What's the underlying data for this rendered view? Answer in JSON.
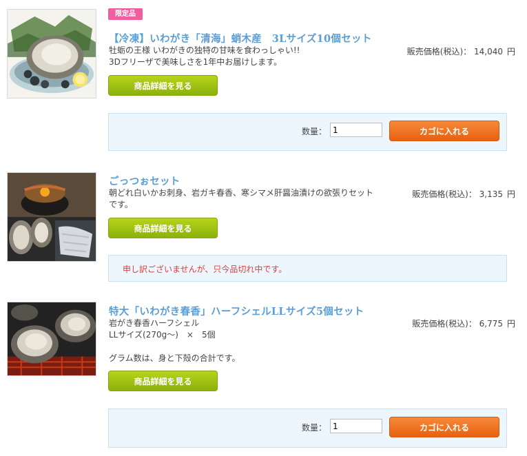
{
  "products": [
    {
      "badge": "限定品",
      "title": "【冷凍】いわがき「清海」蛸木産　3Lサイズ10個セット",
      "desc": [
        "牡蛎の王様 いわがきの独特の甘味を食わっしゃい!!",
        "3Dフリーザで美味しさを1年中お届けします。"
      ],
      "price_label": "販売価格(税込)：",
      "price": "14,040",
      "yen": "円",
      "detail_button": "商品詳細を見る",
      "qty_label": "数量：",
      "qty_value": "1",
      "cart_button": "カゴに入れる"
    },
    {
      "title": "ごっつぉセット",
      "desc": [
        "朝どれ白いかお刺身、岩ガキ春香、寒シマメ肝醤油漬けの欲張りセット",
        "です。"
      ],
      "price_label": "販売価格(税込)：",
      "price": "3,135",
      "yen": "円",
      "detail_button": "商品詳細を見る",
      "soldout": "申し訳ございませんが、只今品切れ中です。"
    },
    {
      "title": "特大「いわがき春香」ハーフシェルLLサイズ5個セット",
      "desc": [
        "岩がき春香ハーフシェル",
        "LLサイズ(270g～)　×　5個",
        "",
        "グラム数は、身と下殻の合計です。"
      ],
      "price_label": "販売価格(税込)：",
      "price": "6,775",
      "yen": "円",
      "detail_button": "商品詳細を見る",
      "qty_label": "数量：",
      "qty_value": "1",
      "cart_button": "カゴに入れる"
    }
  ],
  "colors": {
    "title": "#5a9ed6",
    "badge": "#ef5e9e",
    "detail_button": "#9bc112",
    "cart_button": "#ee7020",
    "cart_box": "#eef6fd",
    "soldout_text": "#d8403c"
  }
}
